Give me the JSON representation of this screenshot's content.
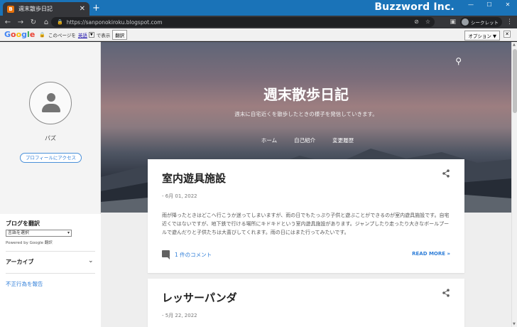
{
  "browser": {
    "tab_title": "週末散歩日記",
    "tab_close": "✕",
    "new_tab": "+",
    "brand_label": "Buzzword Inc.",
    "window_controls": {
      "minimize": "—",
      "maximize": "☐",
      "close": "✕"
    },
    "nav": {
      "back": "←",
      "forward": "→",
      "reload": "↻",
      "home": "⌂"
    },
    "url": "https://sanponokiroku.blogspot.com",
    "omni_icons": [
      "eye-off-icon",
      "star-icon"
    ],
    "incognito_label": "シークレット",
    "menu": "⋮"
  },
  "translate_bar": {
    "logo_letters": [
      "G",
      "o",
      "o",
      "g",
      "l",
      "e"
    ],
    "prefix": "このページを",
    "language": "英語",
    "dropdown": "▼",
    "suffix": "で表示",
    "translate_button": "翻訳",
    "options_button": "オプション ▼",
    "close": "✕"
  },
  "sidebar": {
    "profile_name": "パズ",
    "profile_button": "プロフィールにアクセス",
    "translate_heading": "ブログを翻訳",
    "language_select": "言語を選択",
    "powered_by": "Powered by Google 翻訳",
    "archive_heading": "アーカイブ",
    "archive_chevron": "⌄",
    "report_link": "不正行為を報告"
  },
  "hero": {
    "blog_title": "週末散歩日記",
    "blog_description": "週末に自宅近くを散歩したときの様子を発信していきます。",
    "nav_items": [
      "ホーム",
      "自己紹介",
      "変更履歴"
    ]
  },
  "posts": [
    {
      "title": "室内遊具施設",
      "date": "- 6月 01, 2022",
      "body": "雨が降ったときはどこへ行こうか迷ってしまいますが、雨の日でもたっぷり子供と遊ぶことができるのが室内遊具施設です。自宅近くではないですが、地下鉄で行ける場所にキドキドという室内遊具施設があります。ジャンプしたり走ったり大きなボールプールで遊んだりと子供たちは大喜びしてくれます。雨の日にはまた行ってみたいです。",
      "comments": "1 件のコメント",
      "read_more": "READ MORE »"
    },
    {
      "title": "レッサーパンダ",
      "date": "- 5月 22, 2022"
    }
  ],
  "colors": {
    "brand_bar": "#1a73b8",
    "link": "#2f7ed8",
    "card": "#ffffff"
  }
}
